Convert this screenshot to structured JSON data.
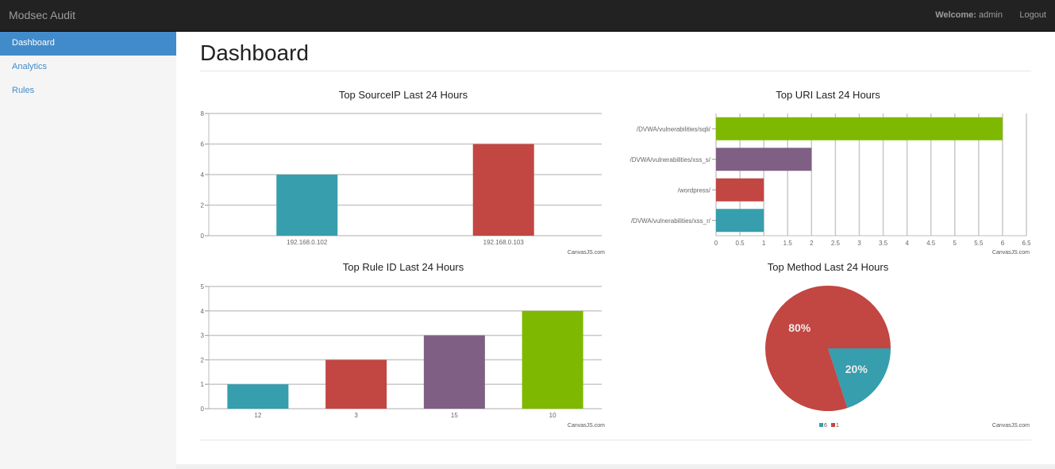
{
  "navbar": {
    "brand": "Modsec Audit",
    "welcome_label": "Welcome:",
    "user": "admin",
    "logout": "Logout"
  },
  "sidebar": {
    "items": [
      {
        "label": "Dashboard",
        "active": true
      },
      {
        "label": "Analytics"
      },
      {
        "label": "Rules"
      }
    ]
  },
  "page": {
    "title": "Dashboard"
  },
  "credit": "CanvasJS.com",
  "chart_data": [
    {
      "type": "bar",
      "title": "Top SourceIP Last 24 Hours",
      "categories": [
        "192.168.0.102",
        "192.168.0.103"
      ],
      "values": [
        4,
        6
      ],
      "colors": [
        "#369EAD",
        "#C24642"
      ],
      "ylim": [
        0,
        8
      ],
      "yticks": [
        "0",
        "2",
        "4",
        "6",
        "8"
      ],
      "grid": true
    },
    {
      "type": "bar",
      "orientation": "horizontal",
      "title": "Top URI Last 24 Hours",
      "categories": [
        "/DVWA/vulnerabilities/sqli/",
        "/DVWA/vulnerabilities/xss_s/",
        "/wordpress/",
        "/DVWA/vulnerabilities/xss_r/"
      ],
      "values": [
        6,
        2,
        1,
        1
      ],
      "colors": [
        "#7FB800",
        "#7F6084",
        "#C24642",
        "#369EAD"
      ],
      "xlim": [
        0,
        6.5
      ],
      "xticks": [
        "0",
        "0.5",
        "1",
        "1.5",
        "2",
        "2.5",
        "3",
        "3.5",
        "4",
        "4.5",
        "5",
        "5.5",
        "6",
        "6.5"
      ],
      "grid": true
    },
    {
      "type": "bar",
      "title": "Top Rule ID Last 24 Hours",
      "categories": [
        "12",
        "3",
        "15",
        "10"
      ],
      "values": [
        1,
        2,
        3,
        4
      ],
      "colors": [
        "#369EAD",
        "#C24642",
        "#7F6084",
        "#7FB800"
      ],
      "ylim": [
        0,
        5
      ],
      "yticks": [
        "0",
        "1",
        "2",
        "3",
        "4",
        "5"
      ],
      "grid": true
    },
    {
      "type": "pie",
      "title": "Top Method Last 24 Hours",
      "series": [
        {
          "name": "6",
          "value": 20,
          "label": "20%",
          "color": "#369EAD"
        },
        {
          "name": "1",
          "value": 80,
          "label": "80%",
          "color": "#C24642"
        }
      ],
      "legend": "bottom-center"
    }
  ]
}
